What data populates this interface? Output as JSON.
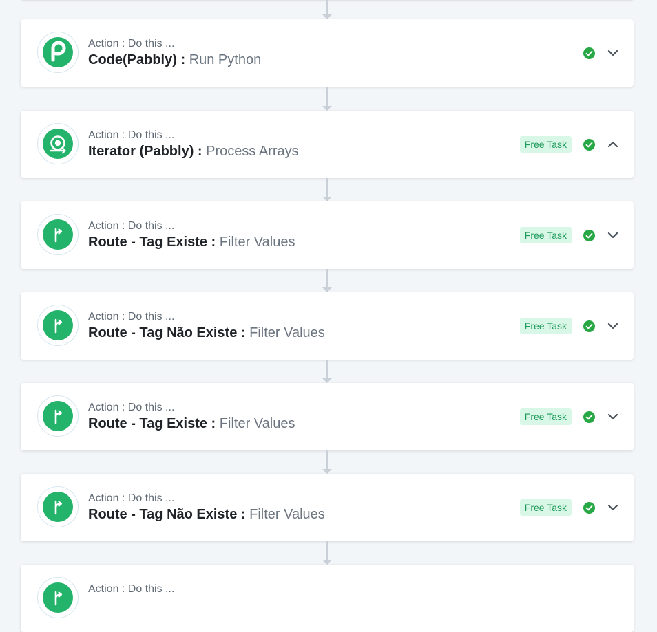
{
  "steps": [
    {
      "caption": "Action : Do this ...",
      "app": "Code(Pabbly)",
      "sep": " : ",
      "event": "Run Python",
      "badge": "",
      "icon": "pabbly-p-icon",
      "expanded": false
    },
    {
      "caption": "Action : Do this ...",
      "app": "Iterator (Pabbly)",
      "sep": " : ",
      "event": "Process Arrays",
      "badge": "Free Task",
      "icon": "iterator-icon",
      "expanded": true
    },
    {
      "caption": "Action : Do this ...",
      "app": "Route - Tag Existe",
      "sep": " : ",
      "event": "Filter Values",
      "badge": "Free Task",
      "icon": "route-icon",
      "expanded": false
    },
    {
      "caption": "Action : Do this ...",
      "app": "Route - Tag Não Existe",
      "sep": " : ",
      "event": "Filter Values",
      "badge": "Free Task",
      "icon": "route-icon",
      "expanded": false
    },
    {
      "caption": "Action : Do this ...",
      "app": "Route - Tag Existe",
      "sep": " : ",
      "event": "Filter Values",
      "badge": "Free Task",
      "icon": "route-icon",
      "expanded": false
    },
    {
      "caption": "Action : Do this ...",
      "app": "Route - Tag Não Existe",
      "sep": " : ",
      "event": "Filter Values",
      "badge": "Free Task",
      "icon": "route-icon",
      "expanded": false
    },
    {
      "caption": "Action : Do this ...",
      "app": "",
      "sep": "",
      "event": "",
      "badge": "",
      "icon": "route-icon",
      "expanded": false
    }
  ],
  "colors": {
    "accent_green": "#24b36b",
    "check_green": "#28a745",
    "badge_bg": "#d9f7e7",
    "badge_text": "#1e9b5b",
    "page_bg": "#f3f6f9"
  },
  "icons": {
    "status": "check-circle-icon",
    "collapsed": "chevron-down-icon",
    "expanded": "chevron-up-icon"
  }
}
